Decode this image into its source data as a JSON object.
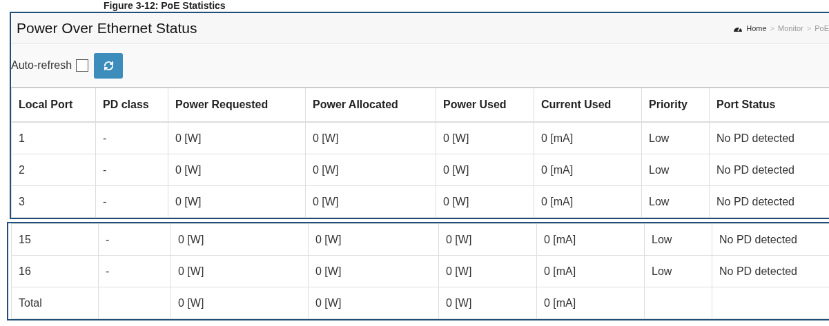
{
  "caption": "Figure 3-12:     PoE Statistics",
  "panel": {
    "title": "Power Over Ethernet Status"
  },
  "breadcrumb": {
    "separator": ">",
    "items": [
      "Home",
      "Monitor",
      "PoE"
    ]
  },
  "auto_refresh": {
    "label": "Auto-refresh",
    "checked": false
  },
  "table": {
    "columns": [
      "Local Port",
      "PD class",
      "Power Requested",
      "Power Allocated",
      "Power Used",
      "Current Used",
      "Priority",
      "Port Status"
    ],
    "segments": [
      {
        "rows": [
          {
            "port": "1",
            "pd_class": "-",
            "requested": "0 [W]",
            "allocated": "0 [W]",
            "used": "0 [W]",
            "current": "0 [mA]",
            "priority": "Low",
            "status": "No PD detected"
          },
          {
            "port": "2",
            "pd_class": "-",
            "requested": "0 [W]",
            "allocated": "0 [W]",
            "used": "0 [W]",
            "current": "0 [mA]",
            "priority": "Low",
            "status": "No PD detected"
          },
          {
            "port": "3",
            "pd_class": "-",
            "requested": "0 [W]",
            "allocated": "0 [W]",
            "used": "0 [W]",
            "current": "0 [mA]",
            "priority": "Low",
            "status": "No PD detected"
          }
        ]
      },
      {
        "rows": [
          {
            "port": "15",
            "pd_class": "-",
            "requested": "0 [W]",
            "allocated": "0 [W]",
            "used": "0 [W]",
            "current": "0 [mA]",
            "priority": "Low",
            "status": "No PD detected"
          },
          {
            "port": "16",
            "pd_class": "-",
            "requested": "0 [W]",
            "allocated": "0 [W]",
            "used": "0 [W]",
            "current": "0 [mA]",
            "priority": "Low",
            "status": "No PD detected"
          },
          {
            "port": "Total",
            "requested": "0 [W]",
            "allocated": "0 [W]",
            "used": "0 [W]",
            "current": "0 [mA]"
          }
        ]
      }
    ]
  }
}
